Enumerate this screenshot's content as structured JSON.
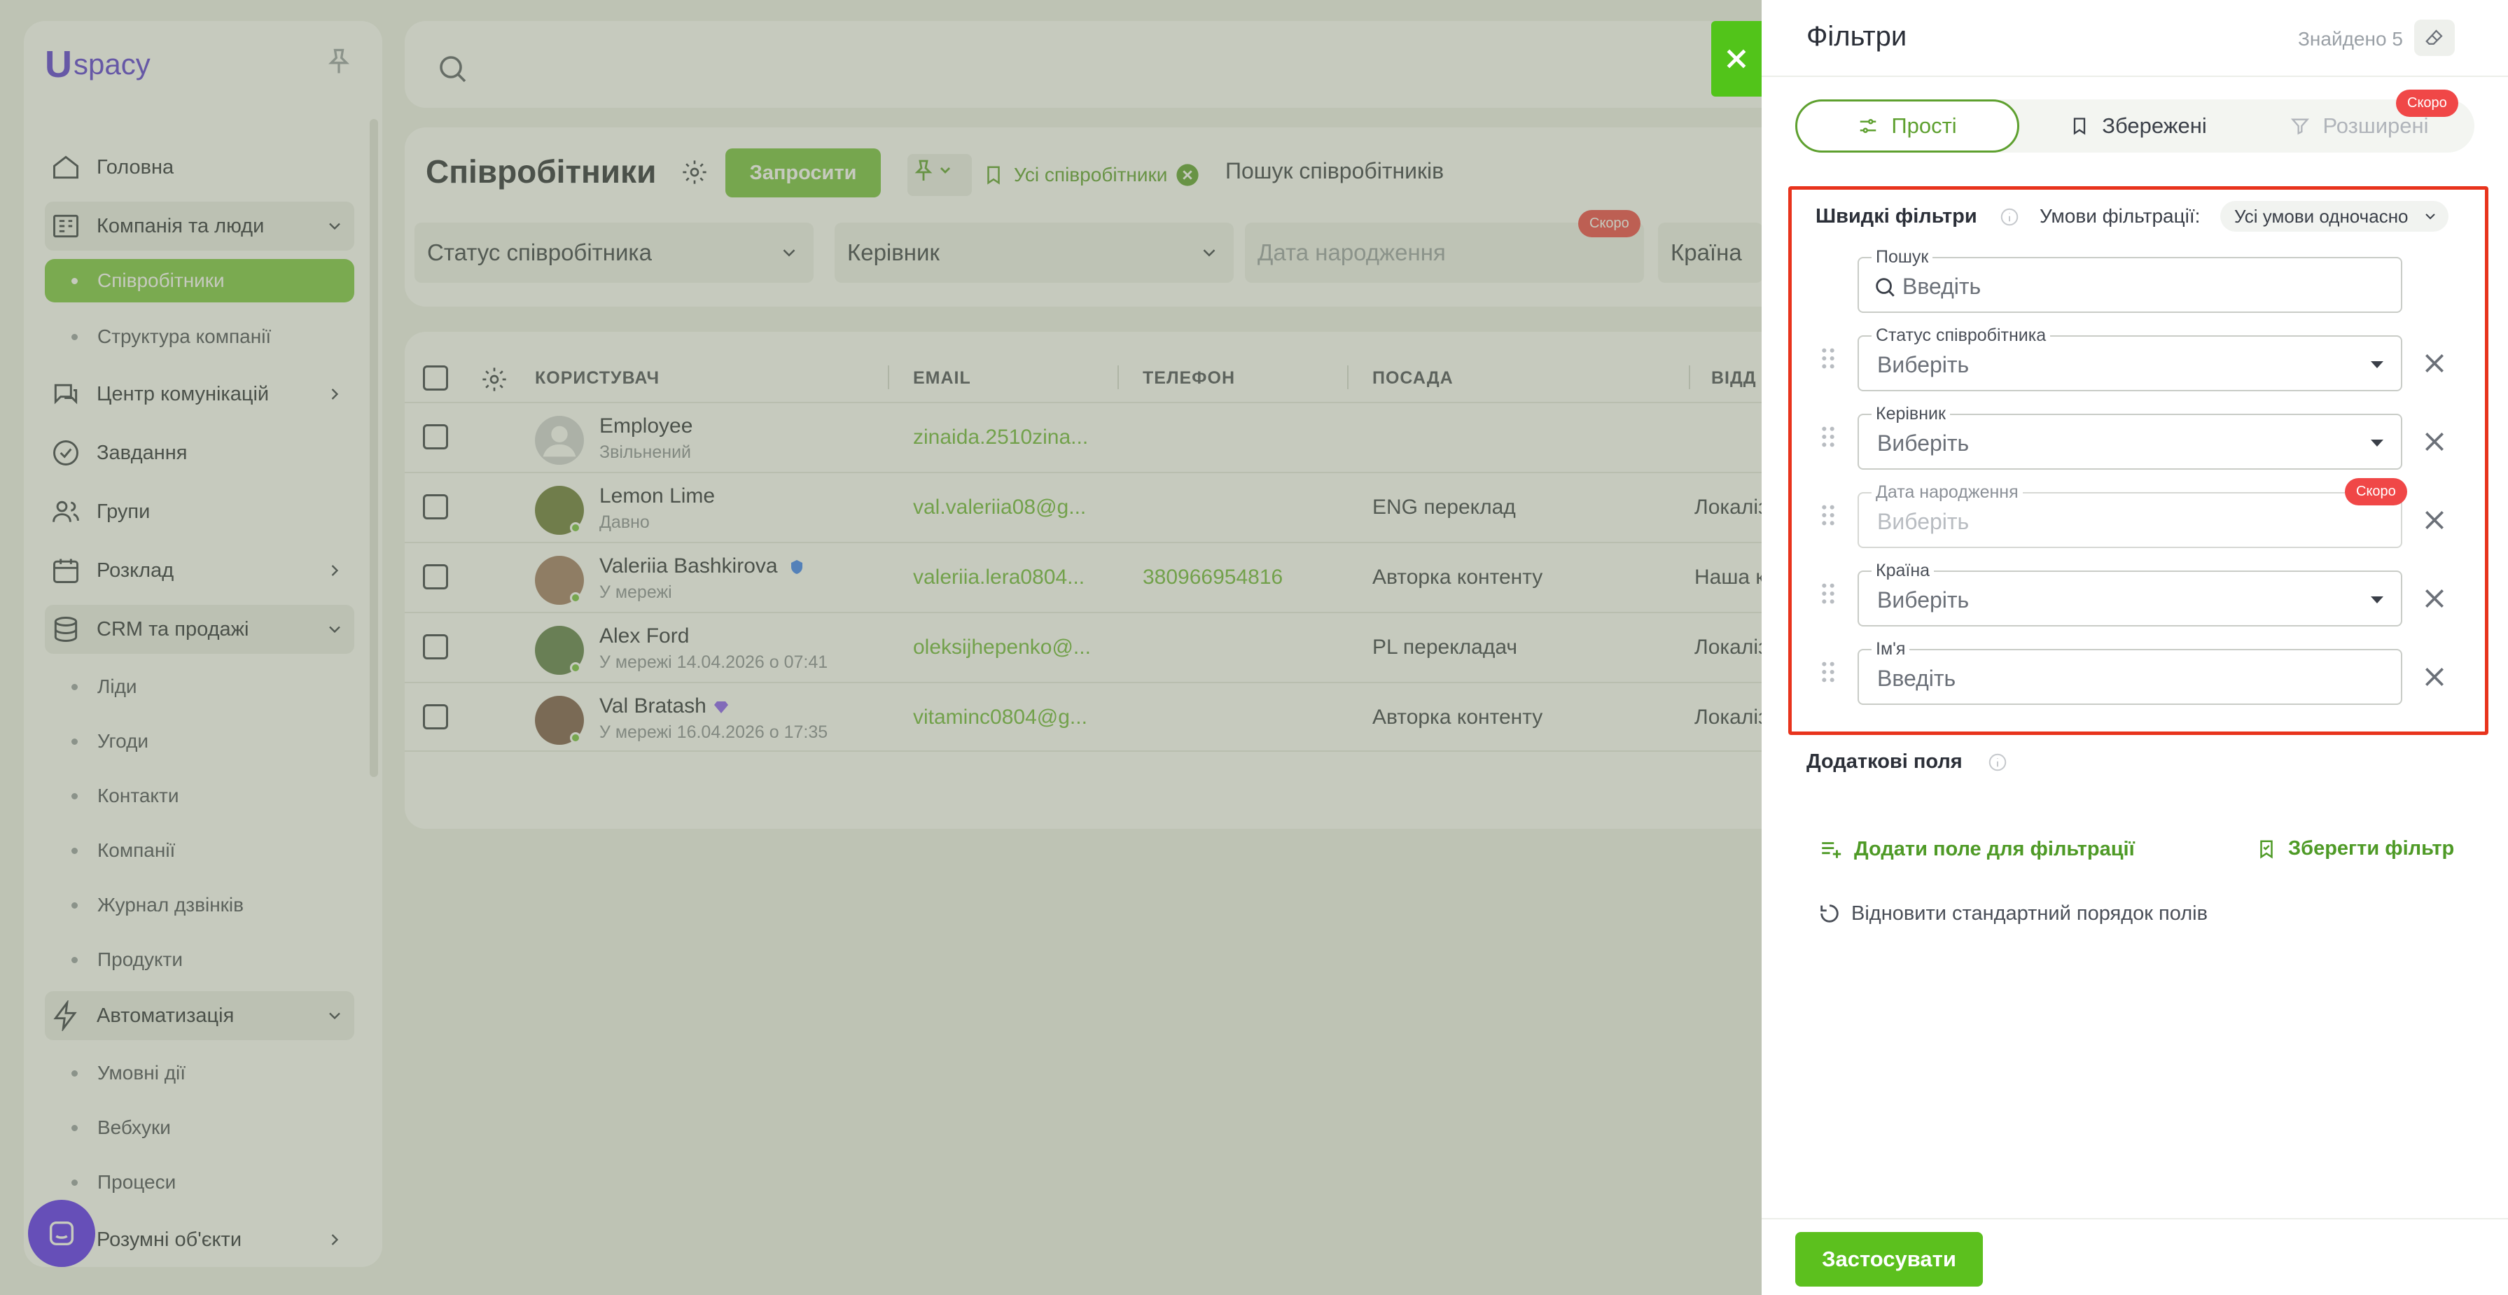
{
  "app": {
    "logo_letter": "U",
    "logo_text": "spacy"
  },
  "sidebar": {
    "items": [
      {
        "label": "Головна",
        "icon": "home-icon"
      },
      {
        "label": "Компанія та люди",
        "icon": "building-icon"
      },
      {
        "label": "Співробітники"
      },
      {
        "label": "Структура компанії"
      },
      {
        "label": "Центр комунікацій",
        "icon": "chat-icon"
      },
      {
        "label": "Завдання",
        "icon": "check-icon"
      },
      {
        "label": "Групи",
        "icon": "group-icon"
      },
      {
        "label": "Розклад",
        "icon": "calendar-icon"
      },
      {
        "label": "CRM та продажі",
        "icon": "database-icon"
      },
      {
        "label": "Ліди"
      },
      {
        "label": "Угоди"
      },
      {
        "label": "Контакти"
      },
      {
        "label": "Компанії"
      },
      {
        "label": "Журнал дзвінків"
      },
      {
        "label": "Продукти"
      },
      {
        "label": "Автоматизація",
        "icon": "bolt-icon"
      },
      {
        "label": "Умовні дії"
      },
      {
        "label": "Вебхуки"
      },
      {
        "label": "Процеси"
      },
      {
        "label": "Розумні об'єкти"
      }
    ]
  },
  "page": {
    "title": "Співробітники",
    "invite_label": "Запросити",
    "all_staff_chip": "Усі співробітники",
    "search_placeholder": "Пошук співробітників",
    "filters": {
      "status": "Статус співробітника",
      "manager": "Керівник",
      "birthdate": "Дата народження",
      "country": "Країна",
      "soon": "Скоро"
    }
  },
  "table": {
    "headers": {
      "user": "КОРИСТУВАЧ",
      "email": "EMAIL",
      "phone": "ТЕЛЕФОН",
      "position": "ПОСАДА",
      "dept": "ВІДД"
    },
    "rows": [
      {
        "name": "Employee",
        "status": "Звільнений",
        "email": "zinaida.2510zina...",
        "phone": "",
        "position": "",
        "dept": "",
        "avatar_color": "#d3d5d8"
      },
      {
        "name": "Lemon Lime",
        "status": "Давно",
        "email": "val.valeriia08@g...",
        "phone": "",
        "position": "ENG переклад",
        "dept": "Локаліз",
        "avatar_color": "#6b7a3a"
      },
      {
        "name": "Valeriia Bashkirova",
        "status": "У мережі",
        "email": "valeriia.lera0804...",
        "phone": "380966954816",
        "position": "Авторка контенту",
        "dept": "Наша к",
        "avatar_color": "#a07a64"
      },
      {
        "name": "Alex Ford",
        "status": "У мережі 14.04.2026 о 07:41",
        "email": "oleksijhepenko@...",
        "phone": "",
        "position": "PL перекладач",
        "dept": "Локаліз",
        "avatar_color": "#5f7e4a"
      },
      {
        "name": "Val Bratash",
        "status": "У мережі 16.04.2026 о 17:35",
        "email": "vitaminc0804@g...",
        "phone": "",
        "position": "Авторка контенту",
        "dept": "Локаліз",
        "avatar_color": "#7d5a4a"
      }
    ]
  },
  "panel": {
    "title": "Фільтри",
    "found": "Знайдено 5",
    "tabs": {
      "simple": "Прості",
      "saved": "Збережені",
      "advanced": "Розширені",
      "soon": "Скоро"
    },
    "quick_title": "Швидкі фільтри",
    "conditions_label": "Умови фільтрації:",
    "conditions_value": "Усі умови одночасно",
    "fields": [
      {
        "label": "Пошук",
        "value": "Введіть"
      },
      {
        "label": "Статус співробітника",
        "value": "Виберіть"
      },
      {
        "label": "Керівник",
        "value": "Виберіть"
      },
      {
        "label": "Дата народження",
        "value": "Виберіть",
        "badge": "Скоро"
      },
      {
        "label": "Країна",
        "value": "Виберіть"
      },
      {
        "label": "Ім'я",
        "value": "Введіть"
      }
    ],
    "additional_title": "Додаткові поля",
    "add_field": "Додати поле для фільтрації",
    "save_filter": "Зберегти фільтр",
    "restore_order": "Відновити стандартний порядок полів",
    "apply": "Застосувати"
  },
  "colors": {
    "accent": "#76c23f",
    "brand": "#5b3bd6",
    "danger": "#f04747",
    "highlight": "#e8331c"
  }
}
